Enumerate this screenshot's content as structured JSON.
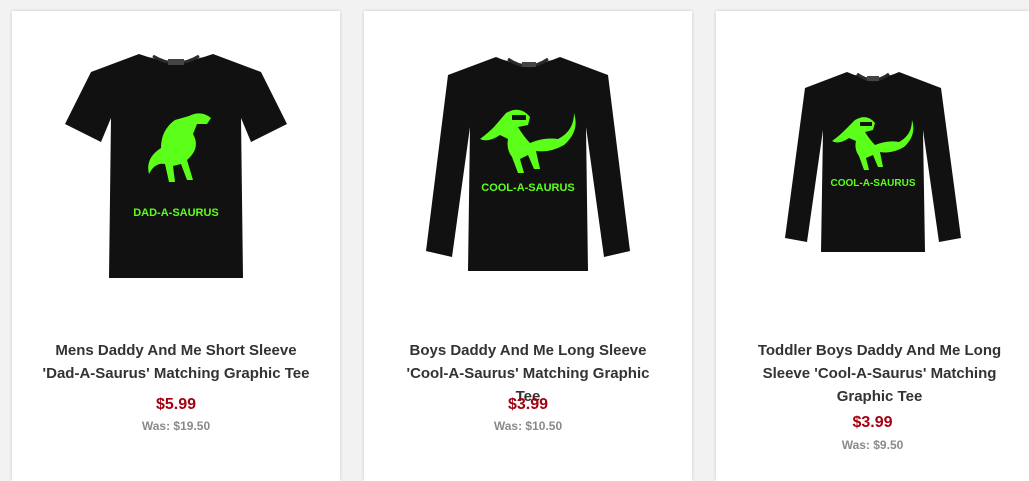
{
  "products": [
    {
      "title_line1": "Mens Daddy And Me Short Sleeve",
      "title_line2": "'Dad-A-Saurus' Matching Graphic Tee",
      "title_line3": "",
      "price": "$5.99",
      "was": "Was: $19.50",
      "graphic_text": "DAD-A-SAURUS"
    },
    {
      "title_line1": "Boys Daddy And Me Long Sleeve",
      "title_line2": "'Cool-A-Saurus' Matching Graphic Tee",
      "title_line3": "",
      "price": "$3.99",
      "was": "Was: $10.50",
      "graphic_text": "COOL-A-SAURUS"
    },
    {
      "title_line1": "Toddler Boys Daddy And Me Long",
      "title_line2": "Sleeve 'Cool-A-Saurus' Matching",
      "title_line3": "Graphic Tee",
      "price": "$3.99",
      "was": "Was: $9.50",
      "graphic_text": "COOL-A-SAURUS"
    }
  ],
  "colors": {
    "shirt": "#111111",
    "neon": "#5cff1a",
    "price": "#a60012",
    "was": "#8a8a8a"
  }
}
